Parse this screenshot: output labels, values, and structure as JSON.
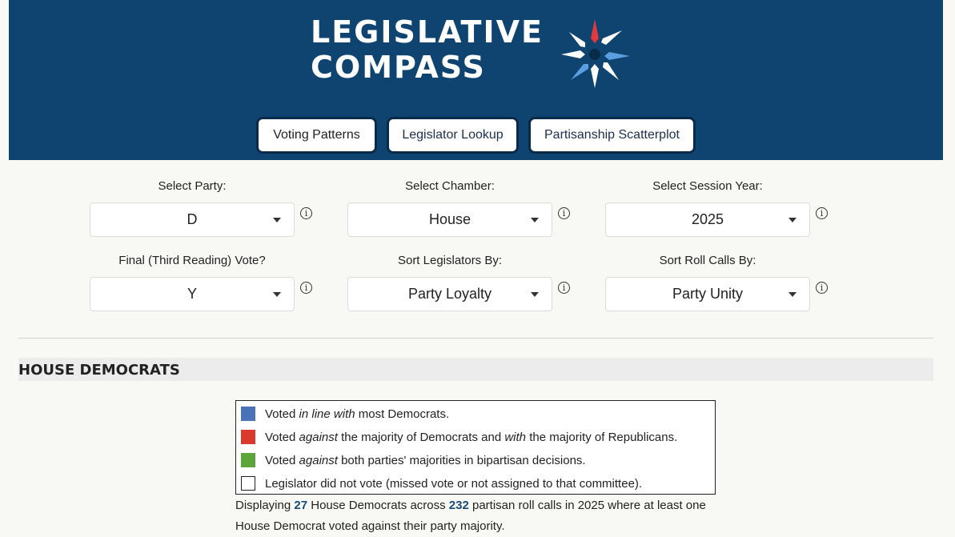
{
  "header": {
    "logo_line1": "LEGISLATIVE",
    "logo_line2": "COMPASS",
    "colors": {
      "background": "#0f4470",
      "star_red": "#e0393e",
      "star_blue": "#5aa0e0",
      "star_white": "#ffffff"
    },
    "tabs": [
      {
        "label": "Voting Patterns",
        "active": true
      },
      {
        "label": "Legislator Lookup",
        "active": false
      },
      {
        "label": "Partisanship Scatterplot",
        "active": false
      }
    ]
  },
  "filters": {
    "party": {
      "label": "Select Party:",
      "value": "D"
    },
    "chamber": {
      "label": "Select Chamber:",
      "value": "House"
    },
    "year": {
      "label": "Select Session Year:",
      "value": "2025"
    },
    "final_vote": {
      "label": "Final (Third Reading) Vote?",
      "value": "Y"
    },
    "sort_legislators": {
      "label": "Sort Legislators By:",
      "value": "Party Loyalty"
    },
    "sort_rollcalls": {
      "label": "Sort Roll Calls By:",
      "value": "Party Unity"
    },
    "info_glyph": "i"
  },
  "section": {
    "title": "HOUSE DEMOCRATS"
  },
  "legend": {
    "items": [
      {
        "color": "#4a72b8",
        "pre": "Voted ",
        "em1": "in line with",
        "mid": " most Democrats.",
        "em2": "",
        "post": ""
      },
      {
        "color": "#d93a2b",
        "pre": "Voted ",
        "em1": "against",
        "mid": " the majority of Democrats and ",
        "em2": "with",
        "post": " the majority of Republicans."
      },
      {
        "color": "#5ba53a",
        "pre": "Voted ",
        "em1": "against",
        "mid": " both parties' majorities in bipartisan decisions.",
        "em2": "",
        "post": ""
      },
      {
        "color": "#ffffff",
        "pre": "Legislator did not vote (missed vote or not assigned to that committee).",
        "em1": "",
        "mid": "",
        "em2": "",
        "post": ""
      }
    ]
  },
  "summary": {
    "t1": "Displaying ",
    "n1": "27",
    "t2": " House Democrats across ",
    "n2": "232",
    "t3": " partisan roll calls in 2025 where at least one House Democrat voted against their party majority."
  }
}
